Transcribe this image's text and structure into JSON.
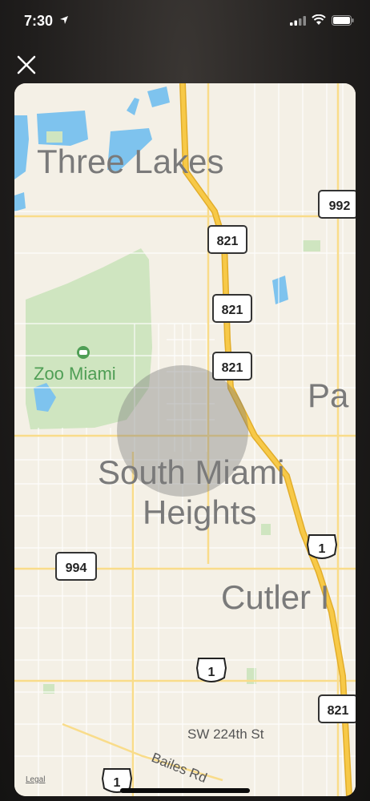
{
  "status_bar": {
    "time": "7:30"
  },
  "map": {
    "places": [
      {
        "id": "three-lakes",
        "label": "Three Lakes"
      },
      {
        "id": "zoo-miami",
        "label": "Zoo Miami"
      },
      {
        "id": "south-miami-heights-1",
        "label": "South Miami"
      },
      {
        "id": "south-miami-heights-2",
        "label": "Heights"
      },
      {
        "id": "cutler",
        "label": "Cutler I"
      },
      {
        "id": "pa",
        "label": "Pa"
      }
    ],
    "streets": [
      {
        "label": "SW 224th St"
      },
      {
        "label": "Bailes Rd"
      }
    ],
    "route_shields": [
      "821",
      "821",
      "821",
      "994",
      "1",
      "1",
      "1",
      "992",
      "821"
    ],
    "legal": "Legal",
    "colors": {
      "land": "#f4f0e6",
      "water": "#7ec3ee",
      "park": "#cfe5c0",
      "highway": "#f7c948",
      "road": "#ffffff",
      "label": "#7a7a7a",
      "poi": "#4f9e55"
    }
  }
}
